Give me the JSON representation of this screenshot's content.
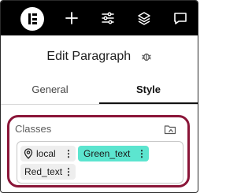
{
  "toolbar": {
    "icons": [
      "elementor-logo-icon",
      "plus-icon",
      "sliders-icon",
      "layers-icon",
      "comment-icon"
    ]
  },
  "panel": {
    "title": "Edit Paragraph"
  },
  "tabs": [
    {
      "label": "General",
      "active": false
    },
    {
      "label": "Style",
      "active": true
    }
  ],
  "classes": {
    "label": "Classes",
    "chips": [
      {
        "label": "local",
        "menu": "⋮"
      },
      {
        "label": "Green_text",
        "menu": "⋮"
      },
      {
        "label": "Red_text",
        "menu": "⋮"
      }
    ]
  },
  "colors": {
    "highlight_border": "#8a1538",
    "green_chip": "#5ce5cf",
    "topbar": "#000000"
  }
}
